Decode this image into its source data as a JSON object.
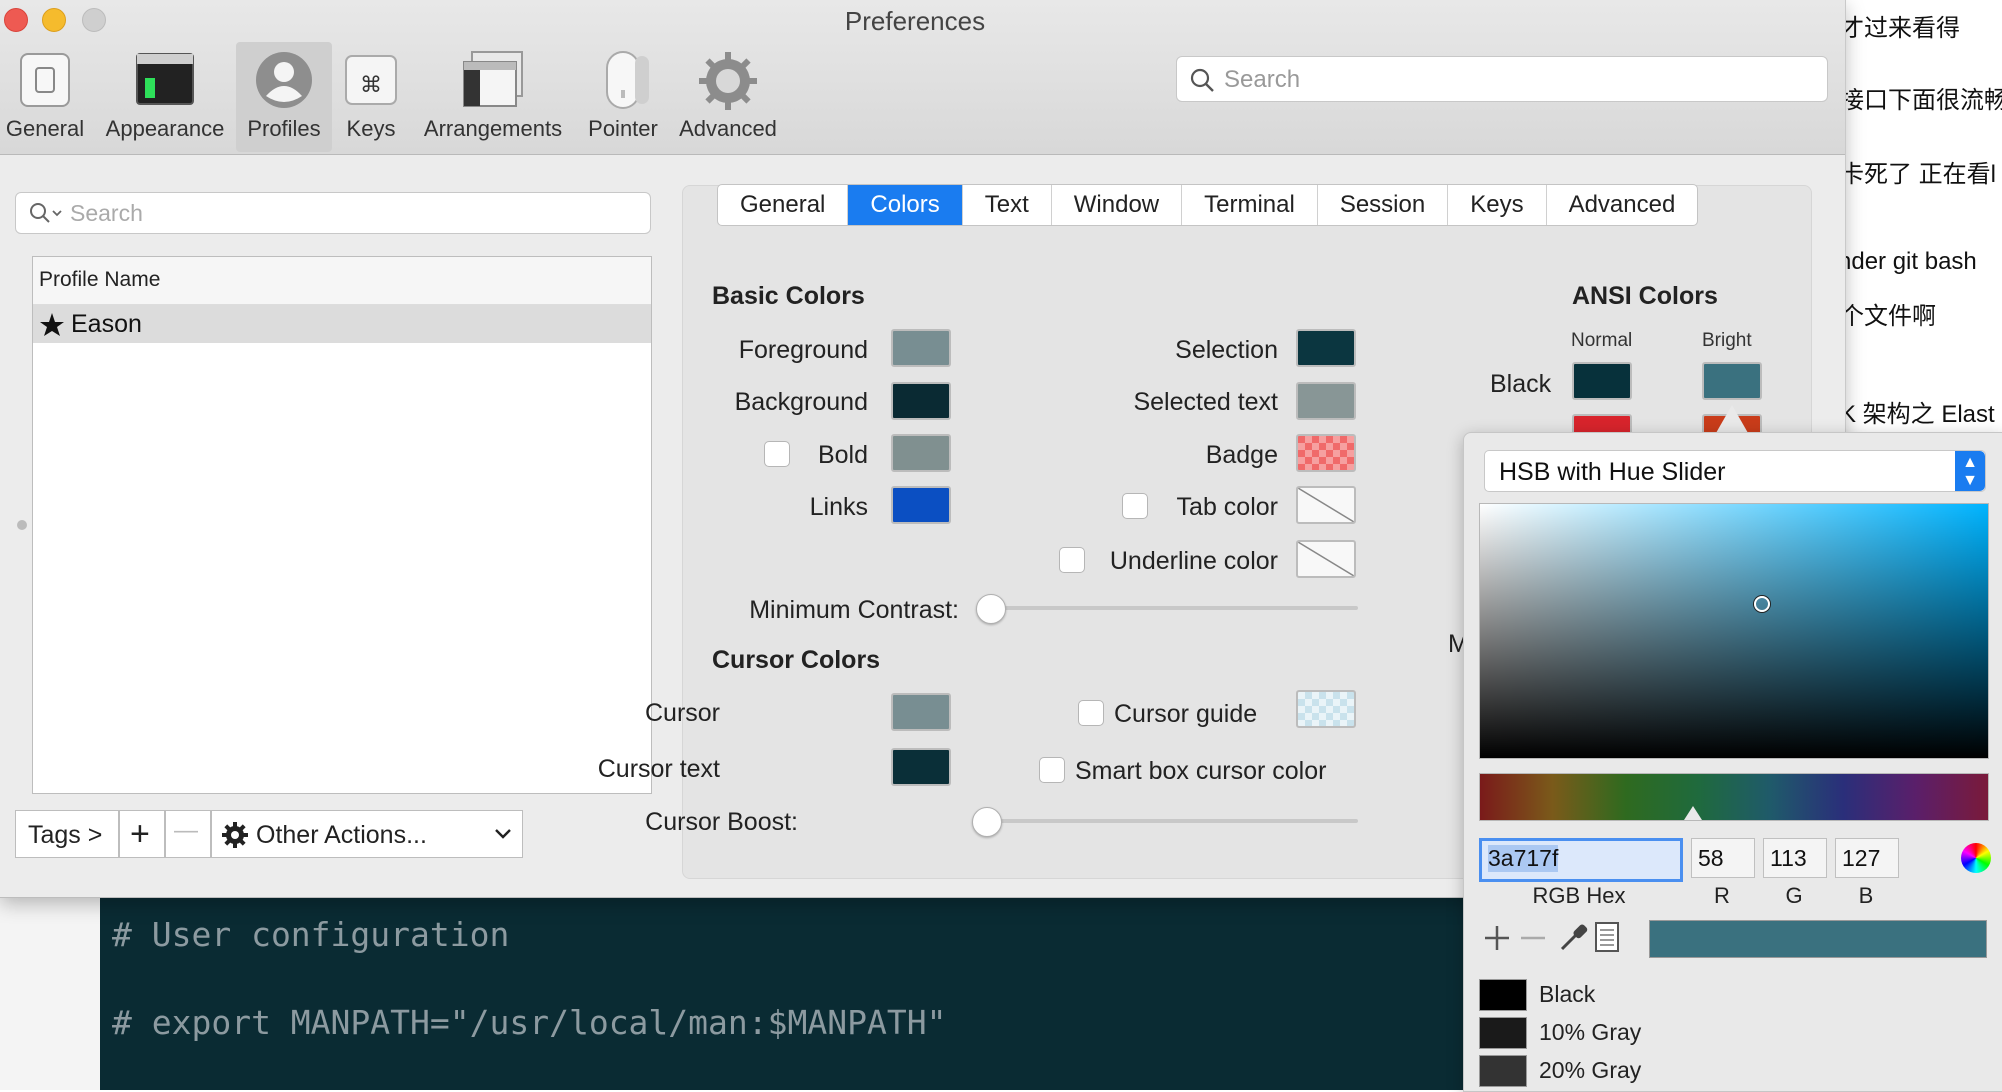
{
  "window": {
    "title": "Preferences"
  },
  "toolbar": {
    "items": [
      {
        "label": "General",
        "icon": "general-icon"
      },
      {
        "label": "Appearance",
        "icon": "appearance-icon"
      },
      {
        "label": "Profiles",
        "icon": "profiles-icon",
        "active": true
      },
      {
        "label": "Keys",
        "icon": "keys-icon"
      },
      {
        "label": "Arrangements",
        "icon": "arrangements-icon"
      },
      {
        "label": "Pointer",
        "icon": "pointer-icon"
      },
      {
        "label": "Advanced",
        "icon": "advanced-icon"
      }
    ],
    "search_placeholder": "Search"
  },
  "profiles": {
    "search_placeholder": "Search",
    "column_header": "Profile Name",
    "rows": [
      {
        "name": "Eason",
        "default": true
      }
    ],
    "tags_label": "Tags >",
    "add_label": "+",
    "remove_label": "—",
    "other_actions_label": "Other Actions..."
  },
  "tabs": [
    "General",
    "Colors",
    "Text",
    "Window",
    "Terminal",
    "Session",
    "Keys",
    "Advanced"
  ],
  "active_tab": "Colors",
  "basic_colors": {
    "title": "Basic Colors",
    "foreground": {
      "label": "Foreground",
      "color": "#788e92"
    },
    "background": {
      "label": "Background",
      "color": "#0a2a33"
    },
    "bold": {
      "label": "Bold",
      "color": "#809090",
      "checked": false
    },
    "links": {
      "label": "Links",
      "color": "#0b4fc2"
    },
    "selection": {
      "label": "Selection",
      "color": "#0b3640"
    },
    "selected_text": {
      "label": "Selected text",
      "color": "#889696"
    },
    "badge": {
      "label": "Badge",
      "color": "#f06a6a"
    },
    "tab_color": {
      "label": "Tab color",
      "checked": false
    },
    "underline_color": {
      "label": "Underline color",
      "checked": false
    },
    "min_contrast_label": "Minimum Contrast:",
    "min_contrast_value": 0
  },
  "cursor_colors": {
    "title": "Cursor Colors",
    "cursor": {
      "label": "Cursor",
      "color": "#788e92"
    },
    "cursor_text": {
      "label": "Cursor text",
      "color": "#0a2f38"
    },
    "cursor_guide": {
      "label": "Cursor guide",
      "checked": false
    },
    "smart_box": {
      "label": "Smart box cursor color",
      "checked": false
    },
    "boost_label": "Cursor Boost:",
    "boost_value": 0
  },
  "ansi": {
    "title": "ANSI Colors",
    "normal_label": "Normal",
    "bright_label": "Bright",
    "black_label": "Black",
    "black_normal": "#07313b",
    "black_bright": "#3a717f",
    "red_normal": "#d8242c",
    "red_bright": "#c93c1a"
  },
  "color_panel": {
    "mode": "HSB with Hue Slider",
    "hex": "3a717f",
    "hex_label": "RGB Hex",
    "r": "58",
    "g": "113",
    "b": "127",
    "r_label": "R",
    "g_label": "G",
    "b_label": "B",
    "current_color": "#3a717f",
    "swatches": [
      {
        "name": "Black",
        "color": "#000000"
      },
      {
        "name": "10% Gray",
        "color": "#1a1a1a"
      },
      {
        "name": "20% Gray",
        "color": "#333333"
      }
    ]
  },
  "terminal": {
    "lines": [
      "# User configuration",
      "# export MANPATH=\"/usr/local/man:$MANPATH\""
    ]
  },
  "background_text": [
    "才过来看得",
    "接口下面很流畅",
    "卡死了 正在看l",
    "nder git bash",
    "个文件啊",
    "K 架构之 Elast"
  ]
}
